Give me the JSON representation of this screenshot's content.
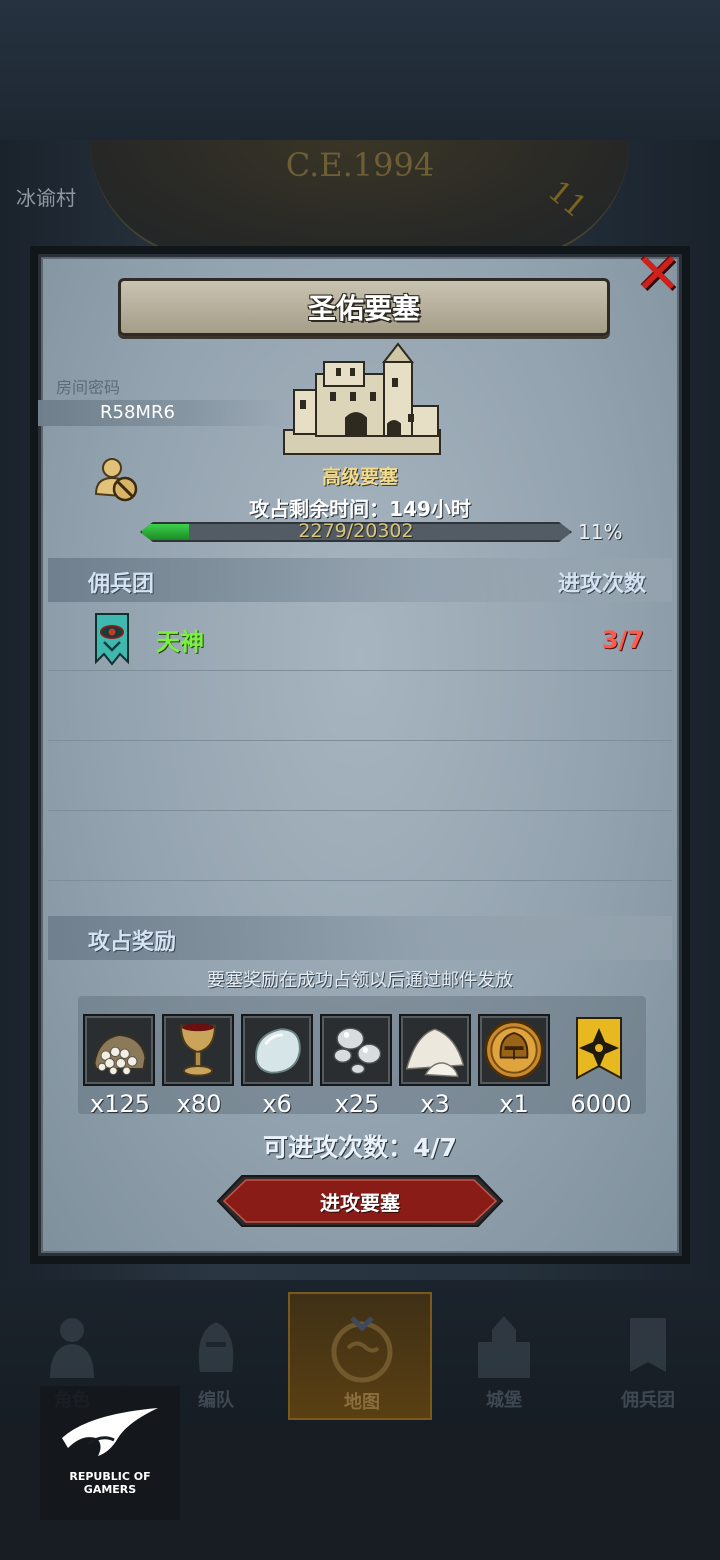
{
  "background": {
    "date": "C.E.1994",
    "village": "冰谕村",
    "clock_hour": "11"
  },
  "dialog": {
    "title": "圣佑要塞",
    "close_icon": "close-icon",
    "room_label": "房间密码",
    "room_code": "R58MR6",
    "fortress_level": "高级要塞",
    "remaining_time": "攻占剩余时间：149小时",
    "progress": {
      "current": 2279,
      "total": 20302,
      "text": "2279/20302",
      "percent_text": "11%",
      "fraction": 0.11
    },
    "mercenary_header": "佣兵团",
    "attack_count_header": "进攻次数",
    "teams": [
      {
        "name": "天神",
        "attacks": "3/7",
        "icon": "eye-banner-icon"
      }
    ],
    "reward_header": "攻占奖励",
    "reward_note": "要塞奖励在成功占领以后通过邮件发放",
    "rewards": [
      {
        "icon": "grain-sack-icon",
        "qty": "x125"
      },
      {
        "icon": "goblet-icon",
        "qty": "x80"
      },
      {
        "icon": "moonstone-icon",
        "qty": "x6"
      },
      {
        "icon": "silver-ore-icon",
        "qty": "x25"
      },
      {
        "icon": "salt-pile-icon",
        "qty": "x3"
      },
      {
        "icon": "knight-helmet-coin-icon",
        "qty": "x1"
      },
      {
        "icon": "honor-banner-icon",
        "qty": "6000"
      }
    ],
    "attack_remaining": "可进攻次数：4/7",
    "attack_button": "进攻要塞"
  },
  "nav": {
    "items": [
      {
        "label": "角色",
        "icon": "character-icon",
        "active": false
      },
      {
        "label": "编队",
        "icon": "formation-icon",
        "active": false
      },
      {
        "label": "地图",
        "icon": "map-icon",
        "active": true
      },
      {
        "label": "城堡",
        "icon": "castle-icon",
        "active": false
      },
      {
        "label": "佣兵团",
        "icon": "mercenary-icon",
        "active": false
      }
    ]
  },
  "rog": {
    "text": "REPUBLIC OF\nGAMERS"
  },
  "colors": {
    "team_name": "#7cf03e",
    "attack_count": "#ff5a4a",
    "fortress_level": "#f1dc8e",
    "progress_fill": "#3dd14b",
    "attack_button": "#8a1c18"
  }
}
